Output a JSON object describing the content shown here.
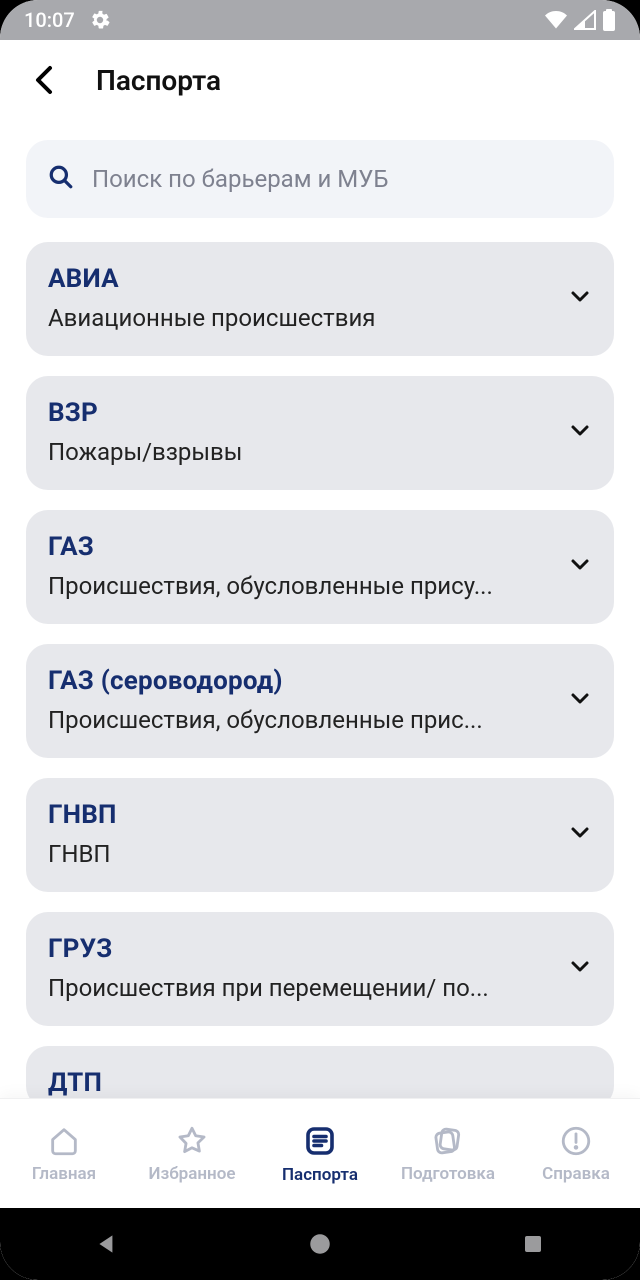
{
  "status": {
    "time": "10:07"
  },
  "header": {
    "title": "Паспорта"
  },
  "search": {
    "placeholder": "Поиск по барьерам и МУБ"
  },
  "cards": [
    {
      "title": "АВИА",
      "sub": "Авиационные происшествия"
    },
    {
      "title": "ВЗР",
      "sub": "Пожары/взрывы"
    },
    {
      "title": "ГАЗ",
      "sub": "Происшествия, обусловленные прису..."
    },
    {
      "title": "ГАЗ (сероводород)",
      "sub": "Происшествия, обусловленные  прис..."
    },
    {
      "title": "ГНВП",
      "sub": "ГНВП"
    },
    {
      "title": "ГРУЗ",
      "sub": "Происшествия при перемещении/ по..."
    },
    {
      "title": "ДТП",
      "sub": ""
    }
  ],
  "nav": {
    "items": [
      {
        "label": "Главная"
      },
      {
        "label": "Избранное"
      },
      {
        "label": "Паспорта"
      },
      {
        "label": "Подготовка"
      },
      {
        "label": "Справка"
      }
    ],
    "active_index": 2
  }
}
